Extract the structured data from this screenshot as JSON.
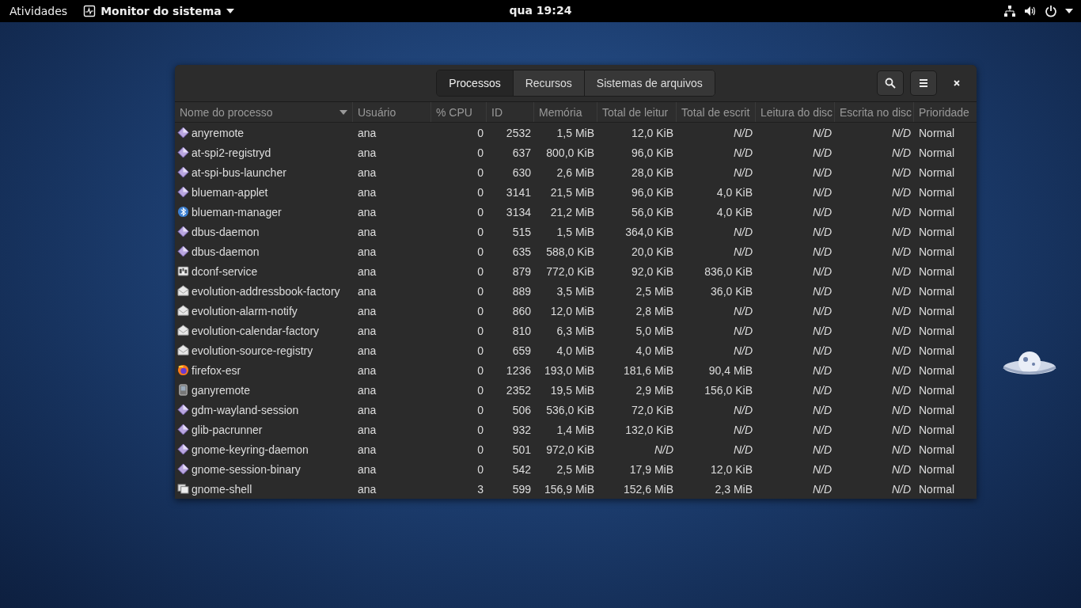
{
  "top_bar": {
    "activities": "Atividades",
    "app_menu": "Monitor do sistema",
    "clock": "qua 19:24"
  },
  "window": {
    "tabs": [
      {
        "label": "Processos",
        "selected": true
      },
      {
        "label": "Recursos",
        "selected": false
      },
      {
        "label": "Sistemas de arquivos",
        "selected": false
      }
    ]
  },
  "table": {
    "columns": [
      {
        "label": "Nome do processo",
        "sorted": true
      },
      {
        "label": "Usuário",
        "sorted": false
      },
      {
        "label": "% CPU",
        "sorted": false
      },
      {
        "label": "ID",
        "sorted": false
      },
      {
        "label": "Memória",
        "sorted": false
      },
      {
        "label": "Total de leitur",
        "sorted": false
      },
      {
        "label": "Total de escrit",
        "sorted": false
      },
      {
        "label": "Leitura do disc",
        "sorted": false
      },
      {
        "label": "Escrita no disc",
        "sorted": false
      },
      {
        "label": "Prioridade",
        "sorted": false
      }
    ],
    "rows": [
      {
        "kind": "diamond",
        "cells": [
          "anyremote",
          "ana",
          "0",
          "2532",
          "1,5 MiB",
          "12,0 KiB",
          "*N/D*",
          "*N/D*",
          "*N/D*",
          "Normal"
        ]
      },
      {
        "kind": "diamond",
        "cells": [
          "at-spi2-registryd",
          "ana",
          "0",
          "637",
          "800,0 KiB",
          "96,0 KiB",
          "*N/D*",
          "*N/D*",
          "*N/D*",
          "Normal"
        ]
      },
      {
        "kind": "diamond",
        "cells": [
          "at-spi-bus-launcher",
          "ana",
          "0",
          "630",
          "2,6 MiB",
          "28,0 KiB",
          "*N/D*",
          "*N/D*",
          "*N/D*",
          "Normal"
        ]
      },
      {
        "kind": "diamond",
        "cells": [
          "blueman-applet",
          "ana",
          "0",
          "3141",
          "21,5 MiB",
          "96,0 KiB",
          "4,0 KiB",
          "*N/D*",
          "*N/D*",
          "Normal"
        ]
      },
      {
        "kind": "bluetooth",
        "cells": [
          "blueman-manager",
          "ana",
          "0",
          "3134",
          "21,2 MiB",
          "56,0 KiB",
          "4,0 KiB",
          "*N/D*",
          "*N/D*",
          "Normal"
        ]
      },
      {
        "kind": "diamond",
        "cells": [
          "dbus-daemon",
          "ana",
          "0",
          "515",
          "1,5 MiB",
          "364,0 KiB",
          "*N/D*",
          "*N/D*",
          "*N/D*",
          "Normal"
        ]
      },
      {
        "kind": "diamond",
        "cells": [
          "dbus-daemon",
          "ana",
          "0",
          "635",
          "588,0 KiB",
          "20,0 KiB",
          "*N/D*",
          "*N/D*",
          "*N/D*",
          "Normal"
        ]
      },
      {
        "kind": "panel",
        "cells": [
          "dconf-service",
          "ana",
          "0",
          "879",
          "772,0 KiB",
          "92,0 KiB",
          "836,0 KiB",
          "*N/D*",
          "*N/D*",
          "Normal"
        ]
      },
      {
        "kind": "envelope",
        "cells": [
          "evolution-addressbook-factory",
          "ana",
          "0",
          "889",
          "3,5 MiB",
          "2,5 MiB",
          "36,0 KiB",
          "*N/D*",
          "*N/D*",
          "Normal"
        ]
      },
      {
        "kind": "envelope",
        "cells": [
          "evolution-alarm-notify",
          "ana",
          "0",
          "860",
          "12,0 MiB",
          "2,8 MiB",
          "*N/D*",
          "*N/D*",
          "*N/D*",
          "Normal"
        ]
      },
      {
        "kind": "envelope",
        "cells": [
          "evolution-calendar-factory",
          "ana",
          "0",
          "810",
          "6,3 MiB",
          "5,0 MiB",
          "*N/D*",
          "*N/D*",
          "*N/D*",
          "Normal"
        ]
      },
      {
        "kind": "envelope",
        "cells": [
          "evolution-source-registry",
          "ana",
          "0",
          "659",
          "4,0 MiB",
          "4,0 MiB",
          "*N/D*",
          "*N/D*",
          "*N/D*",
          "Normal"
        ]
      },
      {
        "kind": "globe",
        "cells": [
          "firefox-esr",
          "ana",
          "0",
          "1236",
          "193,0 MiB",
          "181,6 MiB",
          "90,4 MiB",
          "*N/D*",
          "*N/D*",
          "Normal"
        ]
      },
      {
        "kind": "phone",
        "cells": [
          "ganyremote",
          "ana",
          "0",
          "2352",
          "19,5 MiB",
          "2,9 MiB",
          "156,0 KiB",
          "*N/D*",
          "*N/D*",
          "Normal"
        ]
      },
      {
        "kind": "diamond",
        "cells": [
          "gdm-wayland-session",
          "ana",
          "0",
          "506",
          "536,0 KiB",
          "72,0 KiB",
          "*N/D*",
          "*N/D*",
          "*N/D*",
          "Normal"
        ]
      },
      {
        "kind": "diamond",
        "cells": [
          "glib-pacrunner",
          "ana",
          "0",
          "932",
          "1,4 MiB",
          "132,0 KiB",
          "*N/D*",
          "*N/D*",
          "*N/D*",
          "Normal"
        ]
      },
      {
        "kind": "diamond",
        "cells": [
          "gnome-keyring-daemon",
          "ana",
          "0",
          "501",
          "972,0 KiB",
          "*N/D*",
          "*N/D*",
          "*N/D*",
          "*N/D*",
          "Normal"
        ]
      },
      {
        "kind": "diamond",
        "cells": [
          "gnome-session-binary",
          "ana",
          "0",
          "542",
          "2,5 MiB",
          "17,9 MiB",
          "12,0 KiB",
          "*N/D*",
          "*N/D*",
          "Normal"
        ]
      },
      {
        "kind": "windows",
        "cells": [
          "gnome-shell",
          "ana",
          "3",
          "599",
          "156,9 MiB",
          "152,6 MiB",
          "2,3 MiB",
          "*N/D*",
          "*N/D*",
          "Normal"
        ]
      }
    ]
  }
}
